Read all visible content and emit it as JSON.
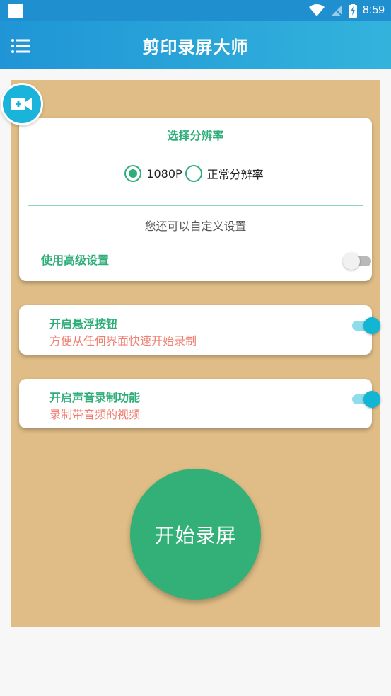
{
  "status_bar": {
    "time": "8:59"
  },
  "app_bar": {
    "title": "剪印录屏大师"
  },
  "resolution_card": {
    "title": "选择分辨率",
    "options": [
      {
        "label": "1080P",
        "checked": true
      },
      {
        "label": "正常分辨率",
        "checked": false
      }
    ],
    "custom_hint": "您还可以自定义设置",
    "advanced_label": "使用高级设置",
    "advanced_enabled": false
  },
  "floating_button_card": {
    "title": "开启悬浮按钮",
    "subtitle": "方便从任何界面快速开始录制",
    "enabled": true
  },
  "audio_card": {
    "title": "开启声音录制功能",
    "subtitle": "录制带音频的视频",
    "enabled": true
  },
  "start_button": {
    "label": "开始录屏"
  },
  "colors": {
    "app_bar_start": "#1f95d6",
    "app_bar_end": "#33b3dc",
    "panel_bg": "#e0bd87",
    "accent_green": "#2fae7a",
    "accent_cyan": "#12b5d4",
    "subtitle_red": "#ef7f72"
  },
  "icons": {
    "menu": "menu-icon",
    "camera": "video-camera-add-icon",
    "wifi": "wifi-icon",
    "signal": "signal-off-icon",
    "battery": "battery-charging-icon"
  }
}
